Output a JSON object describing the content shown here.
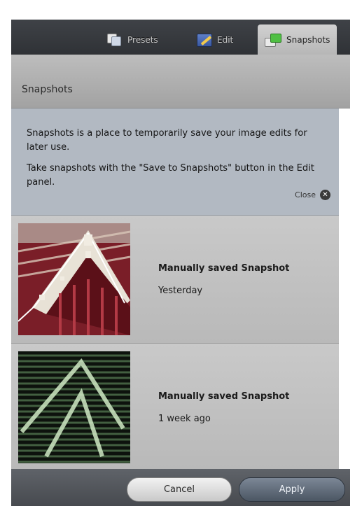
{
  "tabs": [
    {
      "label": "Presets",
      "icon": "presets-icon",
      "active": false
    },
    {
      "label": "Edit",
      "icon": "edit-icon",
      "active": false
    },
    {
      "label": "Snapshots",
      "icon": "snapshots-icon",
      "active": true
    }
  ],
  "header": {
    "title": "Snapshots"
  },
  "info": {
    "line1": "Snapshots is a place to temporarily save your image edits for later use.",
    "line2": "Take snapshots with the \"Save to Snapshots\" button in the Edit panel.",
    "close_label": "Close"
  },
  "snapshots": [
    {
      "title": "Manually saved Snapshot",
      "date": "Yesterday",
      "thumbnail": "pagoda-roof-photo"
    },
    {
      "title": "Manually saved Snapshot",
      "date": "1 week ago",
      "thumbnail": "striped-green-pattern"
    }
  ],
  "footer": {
    "cancel_label": "Cancel",
    "apply_label": "Apply"
  },
  "colors": {
    "accent": "#4fbf43",
    "info_bg": "#b2b9c2",
    "apply_button": "#5c6775"
  }
}
